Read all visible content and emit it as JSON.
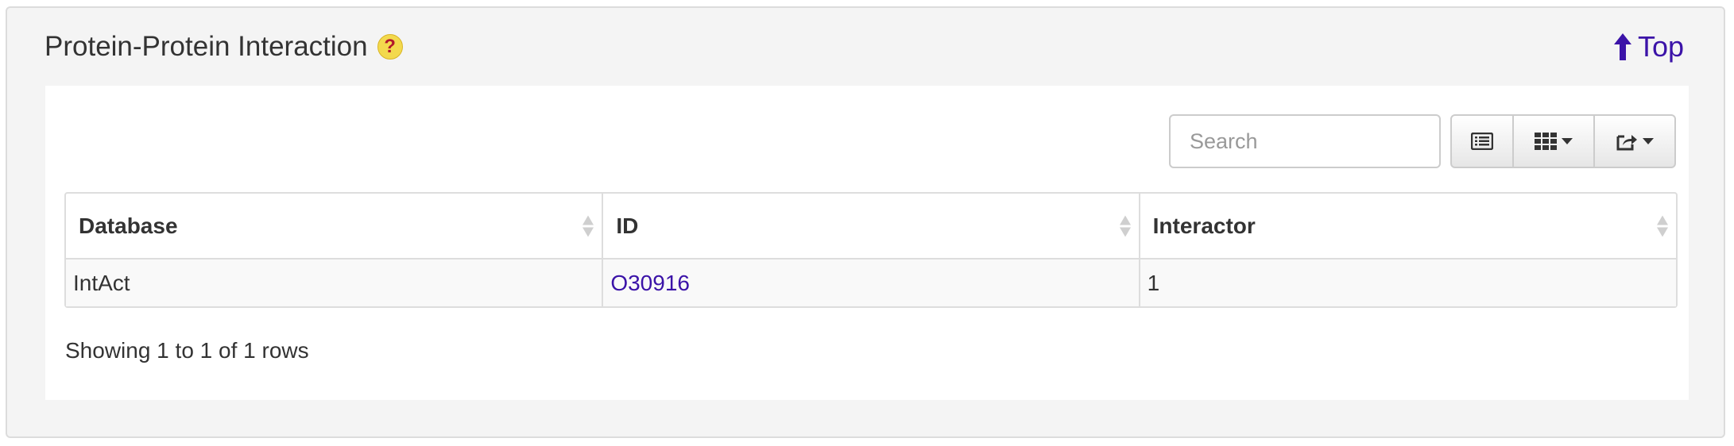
{
  "section": {
    "title": "Protein-Protein Interaction",
    "help_glyph": "?",
    "top_link_label": "Top"
  },
  "toolbar": {
    "search_placeholder": "Search",
    "buttons": [
      "toggle-view-icon",
      "columns-icon",
      "export-icon"
    ]
  },
  "table": {
    "columns": [
      "Database",
      "ID",
      "Interactor"
    ],
    "rows": [
      {
        "database": "IntAct",
        "id": "O30916",
        "interactor": "1"
      }
    ]
  },
  "pagination": {
    "info": "Showing 1 to 1 of 1 rows"
  },
  "colors": {
    "link": "#3b13a8",
    "panel_bg": "#f4f4f4",
    "help_icon_bg": "#f3d94d"
  }
}
